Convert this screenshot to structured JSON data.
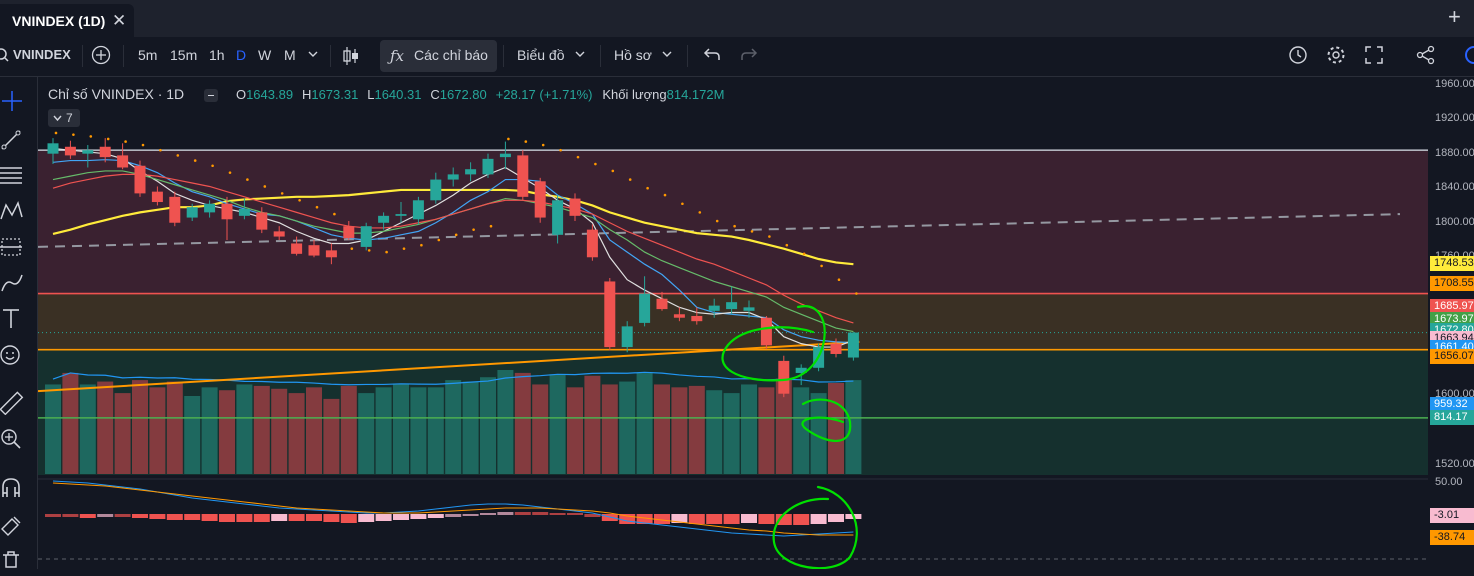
{
  "tab": {
    "title": "VNINDEX (1D)"
  },
  "toolbar": {
    "symbol": "VNINDEX",
    "intervals": [
      "5m",
      "15m",
      "1h",
      "D",
      "W",
      "M"
    ],
    "active_interval": "D",
    "indicators_label": "Các chỉ báo",
    "chart_label": "Biểu đồ",
    "profile_label": "Hồ sơ"
  },
  "legend": {
    "title": "Chỉ số VNINDEX · 1D",
    "open_label": "O",
    "open": "1643.89",
    "high_label": "H",
    "high": "1673.31",
    "low_label": "L",
    "low": "1640.31",
    "close_label": "C",
    "close": "1672.80",
    "change": "+28.17 (+1.71%)",
    "volume_label": "Khối lượng",
    "volume": "814.172M",
    "collapsed_count": "7"
  },
  "colors": {
    "up": "#26a69a",
    "down": "#ef5350",
    "background": "#131722",
    "ma_yellow": "#ffeb3b",
    "ma_blue": "#42a5f5",
    "ma_white": "#e0e0e0",
    "ma_green": "#66bb6a",
    "ma_red": "#ef5350",
    "trend_orange": "#ff9800",
    "parabolic_sar": "#ff9800",
    "annotation": "#00e000"
  },
  "chart_data": {
    "type": "candlestick",
    "price_axis": {
      "ticks": [
        1960,
        1920,
        1880,
        1840,
        1800,
        1760,
        1600,
        1520
      ],
      "range": [
        1500,
        1965
      ]
    },
    "candles": [
      {
        "o": 1880,
        "h": 1898,
        "l": 1868,
        "c": 1892
      },
      {
        "o": 1888,
        "h": 1895,
        "l": 1874,
        "c": 1878
      },
      {
        "o": 1880,
        "h": 1890,
        "l": 1864,
        "c": 1884
      },
      {
        "o": 1888,
        "h": 1898,
        "l": 1870,
        "c": 1876
      },
      {
        "o": 1878,
        "h": 1892,
        "l": 1862,
        "c": 1864
      },
      {
        "o": 1866,
        "h": 1872,
        "l": 1830,
        "c": 1834
      },
      {
        "o": 1836,
        "h": 1842,
        "l": 1820,
        "c": 1824
      },
      {
        "o": 1830,
        "h": 1836,
        "l": 1796,
        "c": 1800
      },
      {
        "o": 1806,
        "h": 1822,
        "l": 1802,
        "c": 1818
      },
      {
        "o": 1812,
        "h": 1826,
        "l": 1806,
        "c": 1822
      },
      {
        "o": 1822,
        "h": 1830,
        "l": 1780,
        "c": 1804
      },
      {
        "o": 1808,
        "h": 1828,
        "l": 1804,
        "c": 1816
      },
      {
        "o": 1812,
        "h": 1818,
        "l": 1788,
        "c": 1792
      },
      {
        "o": 1790,
        "h": 1796,
        "l": 1780,
        "c": 1784
      },
      {
        "o": 1776,
        "h": 1784,
        "l": 1762,
        "c": 1764
      },
      {
        "o": 1774,
        "h": 1780,
        "l": 1760,
        "c": 1762
      },
      {
        "o": 1768,
        "h": 1776,
        "l": 1752,
        "c": 1760
      },
      {
        "o": 1796,
        "h": 1802,
        "l": 1780,
        "c": 1782
      },
      {
        "o": 1772,
        "h": 1800,
        "l": 1768,
        "c": 1796
      },
      {
        "o": 1800,
        "h": 1812,
        "l": 1792,
        "c": 1808
      },
      {
        "o": 1808,
        "h": 1824,
        "l": 1800,
        "c": 1810
      },
      {
        "o": 1804,
        "h": 1830,
        "l": 1798,
        "c": 1826
      },
      {
        "o": 1826,
        "h": 1858,
        "l": 1822,
        "c": 1850
      },
      {
        "o": 1850,
        "h": 1864,
        "l": 1842,
        "c": 1856
      },
      {
        "o": 1856,
        "h": 1870,
        "l": 1848,
        "c": 1862
      },
      {
        "o": 1856,
        "h": 1880,
        "l": 1852,
        "c": 1874
      },
      {
        "o": 1876,
        "h": 1894,
        "l": 1862,
        "c": 1880
      },
      {
        "o": 1878,
        "h": 1884,
        "l": 1826,
        "c": 1830
      },
      {
        "o": 1848,
        "h": 1852,
        "l": 1800,
        "c": 1806
      },
      {
        "o": 1786,
        "h": 1832,
        "l": 1776,
        "c": 1826
      },
      {
        "o": 1828,
        "h": 1834,
        "l": 1802,
        "c": 1808
      },
      {
        "o": 1792,
        "h": 1798,
        "l": 1756,
        "c": 1760
      },
      {
        "o": 1732,
        "h": 1736,
        "l": 1652,
        "c": 1656
      },
      {
        "o": 1656,
        "h": 1686,
        "l": 1650,
        "c": 1680
      },
      {
        "o": 1684,
        "h": 1738,
        "l": 1680,
        "c": 1718
      },
      {
        "o": 1712,
        "h": 1720,
        "l": 1698,
        "c": 1700
      },
      {
        "o": 1694,
        "h": 1702,
        "l": 1686,
        "c": 1690
      },
      {
        "o": 1692,
        "h": 1702,
        "l": 1682,
        "c": 1686
      },
      {
        "o": 1698,
        "h": 1712,
        "l": 1690,
        "c": 1704
      },
      {
        "o": 1700,
        "h": 1726,
        "l": 1694,
        "c": 1708
      },
      {
        "o": 1698,
        "h": 1710,
        "l": 1690,
        "c": 1702
      },
      {
        "o": 1690,
        "h": 1692,
        "l": 1654,
        "c": 1658
      },
      {
        "o": 1640,
        "h": 1646,
        "l": 1598,
        "c": 1602
      },
      {
        "o": 1626,
        "h": 1636,
        "l": 1612,
        "c": 1632
      },
      {
        "o": 1632,
        "h": 1660,
        "l": 1628,
        "c": 1656
      },
      {
        "o": 1660,
        "h": 1666,
        "l": 1644,
        "c": 1648
      },
      {
        "o": 1643.89,
        "h": 1673.31,
        "l": 1640.31,
        "c": 1672.8
      }
    ],
    "volume": [
      620,
      700,
      620,
      640,
      560,
      650,
      600,
      640,
      540,
      600,
      580,
      620,
      610,
      590,
      560,
      600,
      520,
      610,
      560,
      600,
      620,
      600,
      600,
      650,
      640,
      670,
      720,
      700,
      620,
      690,
      600,
      680,
      620,
      640,
      700,
      620,
      600,
      610,
      580,
      560,
      620,
      600,
      660,
      600,
      560,
      630,
      650
    ],
    "series": [
      {
        "name": "MA",
        "color": "#ffeb3b",
        "values": [
          1787,
          1792,
          1798,
          1803,
          1808,
          1812,
          1815,
          1818,
          1818,
          1820,
          1825,
          1827,
          1828,
          1829,
          1830,
          1830,
          1831,
          1832,
          1834,
          1836,
          1838,
          1838,
          1838,
          1838,
          1838,
          1838,
          1838,
          1837,
          1833,
          1830,
          1826,
          1820,
          1812,
          1806,
          1800,
          1796,
          1792,
          1788,
          1786,
          1784,
          1780,
          1775,
          1770,
          1764,
          1758,
          1754,
          1752
        ]
      },
      {
        "name": "MA",
        "color": "#42a5f5",
        "values": [
          1870,
          1872,
          1872,
          1873,
          1872,
          1866,
          1858,
          1846,
          1836,
          1830,
          1822,
          1816,
          1810,
          1808,
          1802,
          1794,
          1786,
          1782,
          1780,
          1782,
          1786,
          1790,
          1800,
          1812,
          1826,
          1836,
          1850,
          1850,
          1848,
          1832,
          1822,
          1810,
          1780,
          1766,
          1752,
          1740,
          1722,
          1702,
          1696,
          1694,
          1692,
          1690,
          1676,
          1668,
          1664,
          1662,
          1661
        ]
      },
      {
        "name": "MA",
        "color": "#e0e0e0",
        "values": [
          1886,
          1884,
          1882,
          1880,
          1874,
          1860,
          1848,
          1834,
          1826,
          1820,
          1816,
          1812,
          1806,
          1800,
          1790,
          1782,
          1776,
          1776,
          1780,
          1790,
          1800,
          1810,
          1820,
          1832,
          1846,
          1856,
          1864,
          1852,
          1840,
          1826,
          1816,
          1800,
          1760,
          1734,
          1722,
          1712,
          1702,
          1696,
          1694,
          1696,
          1696,
          1688,
          1668,
          1660,
          1656,
          1656,
          1664
        ]
      },
      {
        "name": "MA",
        "color": "#66bb6a",
        "values": [
          1850,
          1854,
          1858,
          1860,
          1860,
          1856,
          1850,
          1844,
          1838,
          1832,
          1826,
          1818,
          1812,
          1808,
          1802,
          1796,
          1792,
          1788,
          1788,
          1790,
          1794,
          1798,
          1804,
          1810,
          1816,
          1822,
          1828,
          1826,
          1822,
          1818,
          1812,
          1806,
          1792,
          1780,
          1766,
          1756,
          1748,
          1740,
          1732,
          1726,
          1720,
          1714,
          1702,
          1694,
          1686,
          1678,
          1674
        ]
      },
      {
        "name": "MA",
        "color": "#ef5350",
        "values": [
          1840,
          1846,
          1850,
          1854,
          1856,
          1856,
          1854,
          1850,
          1846,
          1842,
          1836,
          1830,
          1824,
          1818,
          1812,
          1806,
          1800,
          1796,
          1794,
          1794,
          1796,
          1800,
          1804,
          1810,
          1816,
          1822,
          1826,
          1826,
          1824,
          1820,
          1816,
          1810,
          1800,
          1790,
          1782,
          1774,
          1766,
          1758,
          1752,
          1744,
          1736,
          1728,
          1716,
          1706,
          1698,
          1690,
          1684
        ]
      }
    ],
    "psar": [
      1904,
      1902,
      1900,
      1897,
      1894,
      1890,
      1884,
      1878,
      1872,
      1866,
      1858,
      1850,
      1842,
      1834,
      1826,
      1818,
      1810,
      1770,
      1768,
      1766,
      1770,
      1774,
      1780,
      1786,
      1792,
      1796,
      1897,
      1894,
      1890,
      1884,
      1876,
      1868,
      1860,
      1850,
      1840,
      1832,
      1822,
      1812,
      1802,
      1796,
      1790,
      1784,
      1774,
      1764,
      1750,
      1734,
      1718
    ],
    "horizontal_levels": [
      {
        "value": 1884,
        "color": "#b2b5be"
      },
      {
        "value": 1718,
        "color": "#ef5350"
      },
      {
        "value": 1672.8,
        "color": "#26a69a",
        "dotted": true
      },
      {
        "value": 1653,
        "color": "#ff9800"
      },
      {
        "value": 1574,
        "color": "#4caf50"
      }
    ],
    "price_labels": [
      {
        "text": "1748.53",
        "bg": "#ffeb3b",
        "fg": "#131722",
        "value": 1753
      },
      {
        "text": "1708.55",
        "bg": "#ff9800",
        "fg": "#131722",
        "value": 1730
      },
      {
        "text": "1685.97",
        "bg": "#ef5350",
        "fg": "#ffffff",
        "value": 1703
      },
      {
        "text": "1673.97",
        "bg": "#43a047",
        "fg": "#ffffff",
        "value": 1688
      },
      {
        "text": "1672.80",
        "bg": "#26a69a",
        "fg": "#ffffff",
        "value": 1676
      },
      {
        "text": "1663.94",
        "bg": "#f8bbd0",
        "fg": "#131722",
        "value": 1666
      },
      {
        "text": "1661.40",
        "bg": "#2196f3",
        "fg": "#ffffff",
        "value": 1656
      },
      {
        "text": "1656.07",
        "bg": "#ff9800",
        "fg": "#131722",
        "value": 1646
      },
      {
        "text": "959.32",
        "bg": "#2196f3",
        "fg": "#ffffff",
        "value": 1590
      },
      {
        "text": "814.17",
        "bg": "#26a69a",
        "fg": "#ffffff",
        "value": 1575
      }
    ],
    "oscillator": {
      "ticks": [
        "50.00"
      ],
      "labels": [
        {
          "text": "-3.01",
          "bg": "#f8bbd0",
          "fg": "#131722"
        },
        {
          "text": "-38.74",
          "bg": "#ff9800",
          "fg": "#131722"
        }
      ]
    }
  }
}
